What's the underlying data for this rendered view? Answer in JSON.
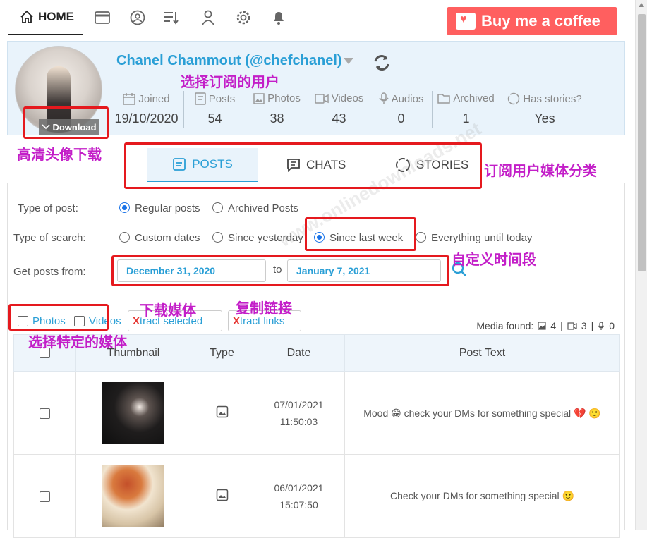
{
  "nav": {
    "home_label": "HOME",
    "buy_coffee_label": "Buy me a coffee"
  },
  "profile": {
    "name": "Chanel Chammout (@chefchanel)",
    "download_label": "Download",
    "stats": [
      {
        "label": "Joined",
        "value": "19/10/2020",
        "icon": "calendar-icon"
      },
      {
        "label": "Posts",
        "value": "54",
        "icon": "post-icon"
      },
      {
        "label": "Photos",
        "value": "38",
        "icon": "photo-icon"
      },
      {
        "label": "Videos",
        "value": "43",
        "icon": "video-icon"
      },
      {
        "label": "Audios",
        "value": "0",
        "icon": "mic-icon"
      },
      {
        "label": "Archived",
        "value": "1",
        "icon": "folder-icon"
      },
      {
        "label": "Has stories?",
        "value": "Yes",
        "icon": "story-icon"
      }
    ]
  },
  "tabs": [
    {
      "label": "POSTS",
      "active": true
    },
    {
      "label": "CHATS",
      "active": false
    },
    {
      "label": "STORIES",
      "active": false
    }
  ],
  "filters": {
    "post_type_label": "Type of post:",
    "post_type_options": [
      "Regular posts",
      "Archived Posts"
    ],
    "post_type_selected": "Regular posts",
    "search_type_label": "Type of search:",
    "search_type_options": [
      "Custom dates",
      "Since yesterday",
      "Since last week",
      "Everything until today"
    ],
    "search_type_selected": "Since last week",
    "get_from_label": "Get posts from:",
    "date_from": "December 31, 2020",
    "to_label": "to",
    "date_to": "January 7, 2021",
    "photos_label": "Photos",
    "videos_label": "Videos",
    "extract_selected_x": "X",
    "extract_selected_rest": "tract selected",
    "extract_links_x": "X",
    "extract_links_rest": "tract links",
    "media_found_label": "Media found:",
    "media_photos": "4",
    "media_videos": "3",
    "media_audios": "0"
  },
  "table": {
    "headers": [
      "",
      "Thumbnail",
      "Type",
      "Date",
      "Post Text"
    ],
    "rows": [
      {
        "date": "07/01/2021",
        "time": "11:50:03",
        "text": "Mood 😁 check your DMs for something special 💔 🙂"
      },
      {
        "date": "06/01/2021",
        "time": "15:07:50",
        "text": "Check your DMs for something special 🙂"
      }
    ]
  },
  "annotations": {
    "select_user": "选择订阅的用户",
    "hd_avatar": "高清头像下载",
    "media_category": "订阅用户媒体分类",
    "custom_period": "自定义时间段",
    "download_media": "下载媒体",
    "copy_link": "复制链接",
    "select_media": "选择特定的媒体"
  },
  "watermark": "www.onlinedownloads.net",
  "colors": {
    "accent": "#2a9fd6",
    "annotation_box": "#e5191e",
    "annotation_text": "#c31ec8",
    "coffee": "#ff5f5f",
    "profile_bg": "#e9f3fb"
  }
}
